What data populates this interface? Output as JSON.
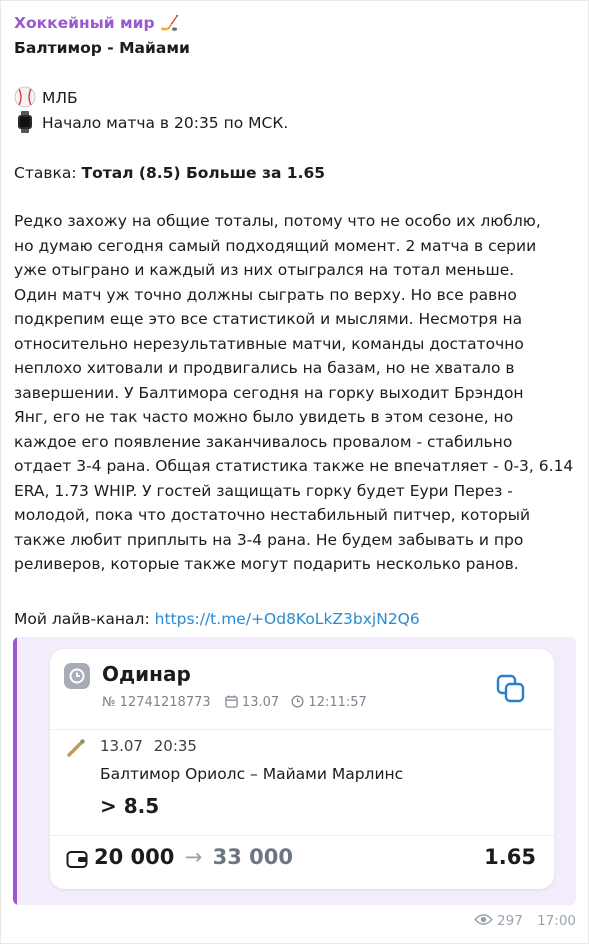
{
  "post": {
    "channel_name": "Хоккейный мир 🏒",
    "title": "Балтимор - Майами",
    "league": "МЛБ",
    "start_time": "Начало матча в 20:35 по МСК.",
    "bet_label": "Ставка:",
    "bet_value": "Тотал (8.5) Больше за 1.65",
    "body_lines": [
      "Редко захожу на общие тоталы, потому что не особо их люблю,",
      "но думаю сегодня самый подходящий момент. 2 матча в серии",
      "уже отыграно и каждый из них отыгрался на тотал меньше.",
      "Один матч уж точно должны сыграть по верху. Но все равно",
      "подкрепим еще это все статистикой и мыслями. Несмотря на",
      "относительно нерезультативные матчи, команды достаточно",
      "неплохо хитовали и продвигались на базам, но не хватало в",
      "завершении. У Балтимора сегодня на горку выходит Брэндон",
      "Янг, его не так часто можно было увидеть в этом сезоне, но",
      "каждое его появление заканчивалось провалом - стабильно",
      "отдает 3-4 рана. Общая статистика также не впечатляет - 0-3, 6.14",
      "ERA, 1.73 WHIP. У гостей защищать горку будет Еури Перез -",
      "молодой, пока что достаточно нестабильный питчер, который",
      "также любит приплыть на 3-4 рана. Не будем забывать и про",
      "реливеров, которые также могут подарить несколько ранов."
    ],
    "live_channel_label": "Мой лайв-канал:",
    "live_channel_link": "https://t.me/+Od8KoLkZ3bxjN2Q6"
  },
  "bet_card": {
    "type": "Одинар",
    "number": "№ 12741218773",
    "date": "13.07",
    "time": "12:11:57",
    "event_date": "13.07",
    "event_time": "20:35",
    "match": "Балтимор Ориолс – Майами Марлинс",
    "outcome": "> 8.5",
    "stake": "20 000",
    "arrow": "→",
    "payout": "33 000",
    "odds": "1.65"
  },
  "footer": {
    "views": "297",
    "time": "17:00"
  },
  "colors": {
    "accent": "#9b59d0",
    "link": "#2a8bd0",
    "card_bg": "#f3ecfb"
  }
}
